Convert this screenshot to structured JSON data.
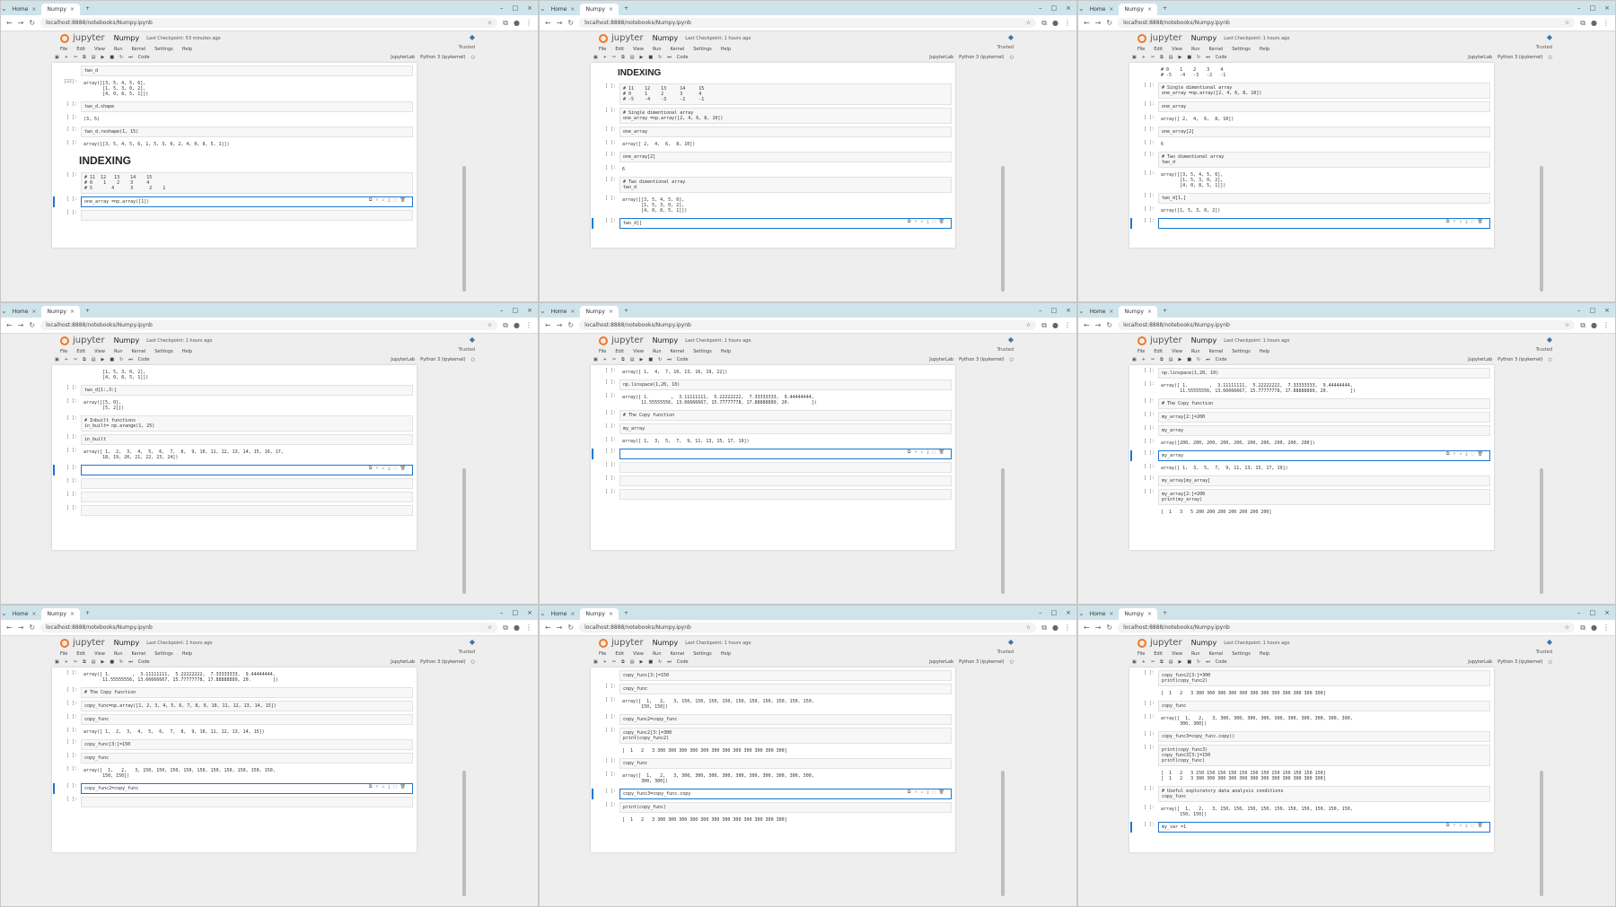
{
  "common": {
    "tab_home": "Home",
    "tab_nb": "Numpy",
    "url": "localhost:8888/notebooks/Numpy.ipynb",
    "brand": "jupyter",
    "title": "Numpy",
    "trusted": "Trusted",
    "kernel": "Python 3 (ipykernel)",
    "jupyterlab": "JupyterLab",
    "celltype": "Code",
    "menus": [
      "File",
      "Edit",
      "View",
      "Run",
      "Kernel",
      "Settings",
      "Help"
    ]
  },
  "windows": [
    {
      "ckpt": "Last Checkpoint: 53 minutes ago",
      "cells": [
        {
          "p": "",
          "t": "two_d",
          "k": "in"
        },
        {
          "p": "[22]:",
          "t": "array([[3, 5, 4, 5, 6],\n       [1, 5, 3, 0, 2],\n       [4, 0, 8, 5, 1]])",
          "k": "out"
        },
        {
          "p": "[ ]:",
          "t": "two_d.shape",
          "k": "in"
        },
        {
          "p": "[ ]:",
          "t": "(3, 5)",
          "k": "out"
        },
        {
          "p": "[ ]:",
          "t": "two_d.reshape(1, 15)",
          "k": "in"
        },
        {
          "p": "[ ]:",
          "t": "array([[3, 5, 4, 5, 6, 1, 5, 3, 0, 2, 4, 0, 8, 5, 1]])",
          "k": "out"
        },
        {
          "md": "INDEXING",
          "size": 12
        },
        {
          "p": "[ ]:",
          "t": "# 11  12   13    14    15\n# 0    1    2    3     4\n# 5       4      3      2    1",
          "k": "in"
        },
        {
          "p": "[ ]:",
          "t": "one_array =np.array([1])",
          "k": "in",
          "a": true
        },
        {
          "p": "[ ]:",
          "t": "",
          "k": "in"
        }
      ]
    },
    {
      "ckpt": "Last Checkpoint: 1 hours ago",
      "cells": [
        {
          "md": "INDEXING",
          "size": 10
        },
        {
          "p": "[ ]:",
          "t": "# 11    12    13     14     15\n# 0     1     2      3      4\n# -5    -4    -3     -2     -1",
          "k": "in"
        },
        {
          "p": "[ ]:",
          "t": "# Single dimentional array\none_array =np.array([2, 4, 6, 8, 10])",
          "k": "in"
        },
        {
          "p": "[ ]:",
          "t": "one_array",
          "k": "in"
        },
        {
          "p": "[ ]:",
          "t": "array([ 2,  4,  6,  8, 10])",
          "k": "out"
        },
        {
          "p": "[ ]:",
          "t": "one_array[2]",
          "k": "in"
        },
        {
          "p": "[ ]:",
          "t": "6",
          "k": "out"
        },
        {
          "p": "[ ]:",
          "t": "# Two dimentional array\ntwo_d",
          "k": "in"
        },
        {
          "p": "[ ]:",
          "t": "array([[3, 5, 4, 5, 6],\n       [1, 5, 3, 0, 2],\n       [4, 0, 8, 5, 1]])",
          "k": "out"
        },
        {
          "p": "[ ]:",
          "t": "two_d[]",
          "k": "in",
          "a": true
        }
      ]
    },
    {
      "ckpt": "Last Checkpoint: 1 hours ago",
      "cells": [
        {
          "p": "",
          "t": "# 0    1    2    3    4\n# -5   -4   -3   -2   -1",
          "k": "out"
        },
        {
          "p": "[ ]:",
          "t": "# Single dimentional array\none_array =np.array([2, 4, 6, 8, 10])",
          "k": "in"
        },
        {
          "p": "[ ]:",
          "t": "one_array",
          "k": "in"
        },
        {
          "p": "[ ]:",
          "t": "array([ 2,  4,  6,  8, 10])",
          "k": "out"
        },
        {
          "p": "[ ]:",
          "t": "one_array[2]",
          "k": "in"
        },
        {
          "p": "[ ]:",
          "t": "6",
          "k": "out"
        },
        {
          "p": "[ ]:",
          "t": "# Two dimentional array\ntwo_d",
          "k": "in"
        },
        {
          "p": "[ ]:",
          "t": "array([[3, 5, 4, 5, 6],\n       [1, 5, 3, 0, 2],\n       [4, 0, 8, 5, 1]])",
          "k": "out"
        },
        {
          "p": "[ ]:",
          "t": "two_d[1,]",
          "k": "in"
        },
        {
          "p": "[ ]:",
          "t": "array([1, 5, 3, 0, 2])",
          "k": "out"
        },
        {
          "p": "[ ]:",
          "t": "",
          "k": "in",
          "a": true
        }
      ]
    },
    {
      "ckpt": "Last Checkpoint: 1 hours ago",
      "cells": [
        {
          "p": "",
          "t": "       [1, 5, 3, 0, 2],\n       [4, 0, 8, 5, 1]])",
          "k": "out"
        },
        {
          "p": "[ ]:",
          "t": "two_d[1:,3:]",
          "k": "in"
        },
        {
          "p": "[ ]:",
          "t": "array([[5, 0],\n       [5, 2]])",
          "k": "out"
        },
        {
          "p": "[ ]:",
          "t": "# Inbuilt functions\nin_built= np.arange(1, 25)",
          "k": "in"
        },
        {
          "p": "[ ]:",
          "t": "in_built",
          "k": "in"
        },
        {
          "p": "[ ]:",
          "t": "array([ 1,  2,  3,  4,  5,  6,  7,  8,  9, 10, 11, 12, 13, 14, 15, 16, 17,\n       18, 19, 20, 21, 22, 23, 24])",
          "k": "out"
        },
        {
          "p": "[ ]:",
          "t": "",
          "k": "in",
          "a": true
        },
        {
          "p": "[ ]:",
          "t": "",
          "k": "in"
        },
        {
          "p": "[ ]:",
          "t": "",
          "k": "in"
        },
        {
          "p": "[ ]:",
          "t": "",
          "k": "in"
        }
      ]
    },
    {
      "ckpt": "Last Checkpoint: 1 hours ago",
      "cells": [
        {
          "p": "[ ]:",
          "t": "array([ 1,  4,  7, 10, 13, 16, 19, 22])",
          "k": "out"
        },
        {
          "p": "[ ]:",
          "t": "np.linspace(1,20, 10)",
          "k": "in"
        },
        {
          "p": "[ ]:",
          "t": "array([ 1.        ,  3.11111111,  5.22222222,  7.33333333,  9.44444444,\n       11.55555556, 13.66666667, 15.77777778, 17.88888889, 20.        ])",
          "k": "out"
        },
        {
          "p": "[ ]:",
          "t": "# The Copy function",
          "k": "in"
        },
        {
          "p": "[ ]:",
          "t": "my_array",
          "k": "in"
        },
        {
          "p": "[ ]:",
          "t": "array([ 1,  3,  5,  7,  9, 11, 13, 15, 17, 19])",
          "k": "out"
        },
        {
          "p": "[ ]:",
          "t": "",
          "k": "in",
          "a": true
        },
        {
          "p": "[ ]:",
          "t": "",
          "k": "in"
        },
        {
          "p": "[ ]:",
          "t": "",
          "k": "in"
        },
        {
          "p": "[ ]:",
          "t": "",
          "k": "in"
        }
      ]
    },
    {
      "ckpt": "Last Checkpoint: 1 hours ago",
      "cells": [
        {
          "p": "[ ]:",
          "t": "np.linspace(1,20, 10)",
          "k": "in"
        },
        {
          "p": "[ ]:",
          "t": "array([ 1.        ,  3.11111111,  5.22222222,  7.33333333,  9.44444444,\n       11.55555556, 13.66666667, 15.77777778, 17.88888889, 20.        ])",
          "k": "out"
        },
        {
          "p": "[ ]:",
          "t": "# The Copy function",
          "k": "in"
        },
        {
          "p": "[ ]:",
          "t": "my_array[2:]=200",
          "k": "in"
        },
        {
          "p": "[ ]:",
          "t": "my_array",
          "k": "in"
        },
        {
          "p": "[ ]:",
          "t": "array([200, 200, 200, 200, 200, 200, 200, 200, 200, 200])",
          "k": "out"
        },
        {
          "p": "[ ]:",
          "t": "my_array",
          "k": "in",
          "a": true
        },
        {
          "p": "[ ]:",
          "t": "array([ 1,  3,  5,  7,  9, 11, 13, 15, 17, 19])",
          "k": "out"
        },
        {
          "p": "[ ]:",
          "t": "my_array[my_array]",
          "k": "in"
        },
        {
          "p": "[ ]:",
          "t": "my_array[2:]=200\nprint(my_array)",
          "k": "in"
        },
        {
          "p": "",
          "t": "[  1   3   5 200 200 200 200 200 200 200]",
          "k": "out"
        }
      ]
    },
    {
      "ckpt": "Last Checkpoint: 1 hours ago",
      "cells": [
        {
          "p": "[ ]:",
          "t": "array([ 1.        ,  3.11111111,  5.22222222,  7.33333333,  9.44444444,\n       11.55555556, 13.66666667, 15.77777778, 17.88888889, 20.        ])",
          "k": "out"
        },
        {
          "p": "[ ]:",
          "t": "# The Copy function",
          "k": "in"
        },
        {
          "p": "[ ]:",
          "t": "copy_func=np.array([1, 2, 3, 4, 5, 6, 7, 8, 9, 10, 11, 12, 13, 14, 15])",
          "k": "in"
        },
        {
          "p": "[ ]:",
          "t": "copy_func",
          "k": "in"
        },
        {
          "p": "[ ]:",
          "t": "array([ 1,  2,  3,  4,  5,  6,  7,  8,  9, 10, 11, 12, 13, 14, 15])",
          "k": "out"
        },
        {
          "p": "[ ]:",
          "t": "copy_func[3:]=150",
          "k": "in"
        },
        {
          "p": "[ ]:",
          "t": "copy_func",
          "k": "in"
        },
        {
          "p": "[ ]:",
          "t": "array([  1,   2,   3, 150, 150, 150, 150, 150, 150, 150, 150, 150, 150,\n       150, 150])",
          "k": "out"
        },
        {
          "p": "[ ]:",
          "t": "copy_func2=copy_func",
          "k": "in",
          "a": true
        },
        {
          "p": "[ ]:",
          "t": "",
          "k": "in"
        }
      ]
    },
    {
      "ckpt": "Last Checkpoint: 1 hours ago",
      "cells": [
        {
          "p": "",
          "t": "copy_func[3:]=150",
          "k": "in"
        },
        {
          "p": "[ ]:",
          "t": "copy_func",
          "k": "in"
        },
        {
          "p": "[ ]:",
          "t": "array([  1,   2,   3, 150, 150, 150, 150, 150, 150, 150, 150, 150, 150,\n       150, 150])",
          "k": "out"
        },
        {
          "p": "[ ]:",
          "t": "copy_func2=copy_func",
          "k": "in"
        },
        {
          "p": "[ ]:",
          "t": "copy_func2[3:]=300\nprint(copy_func2)",
          "k": "in"
        },
        {
          "p": "",
          "t": "[  1   2   3 300 300 300 300 300 300 300 300 300 300 300 300]",
          "k": "out"
        },
        {
          "p": "[ ]:",
          "t": "copy_func",
          "k": "in"
        },
        {
          "p": "[ ]:",
          "t": "array([  1,   2,   3, 300, 300, 300, 300, 300, 300, 300, 300, 300, 300,\n       300, 300])",
          "k": "out"
        },
        {
          "p": "[ ]:",
          "t": "copy_func3=copy_func.copy",
          "k": "in",
          "a": true
        },
        {
          "p": "[ ]:",
          "t": "print(copy_func)",
          "k": "in"
        },
        {
          "p": "",
          "t": "[  1   2   3 300 300 300 300 300 300 300 300 300 300 300 300]",
          "k": "out"
        }
      ]
    },
    {
      "ckpt": "Last Checkpoint: 1 hours ago",
      "cells": [
        {
          "p": "[ ]:",
          "t": "copy_func2[3:]=300\nprint(copy_func2)",
          "k": "in"
        },
        {
          "p": "",
          "t": "[  1   2   3 300 300 300 300 300 300 300 300 300 300 300 300]",
          "k": "out"
        },
        {
          "p": "[ ]:",
          "t": "copy_func",
          "k": "in"
        },
        {
          "p": "[ ]:",
          "t": "array([  1,   2,   3, 300, 300, 300, 300, 300, 300, 300, 300, 300, 300,\n       300, 300])",
          "k": "out"
        },
        {
          "p": "[ ]:",
          "t": "copy_func3=copy_func.copy()",
          "k": "in"
        },
        {
          "p": "[ ]:",
          "t": "print(copy_func3)\ncopy_func3[3:]=150\nprint(copy_func)",
          "k": "in"
        },
        {
          "p": "",
          "t": "[  1   2   3 150 150 150 150 150 150 150 150 150 150 150 150]\n[  1   2   3 300 300 300 300 300 300 300 300 300 300 300 300]",
          "k": "out"
        },
        {
          "p": "[ ]:",
          "t": "# Useful exploratory data analysis conditions\ncopy_func",
          "k": "in"
        },
        {
          "p": "[ ]:",
          "t": "array([  1,   2,   3, 150, 150, 150, 150, 150, 150, 150, 150, 150, 150,\n       150, 150])",
          "k": "out"
        },
        {
          "p": "[ ]:",
          "t": "my_var =1",
          "k": "in",
          "a": true
        }
      ]
    }
  ]
}
